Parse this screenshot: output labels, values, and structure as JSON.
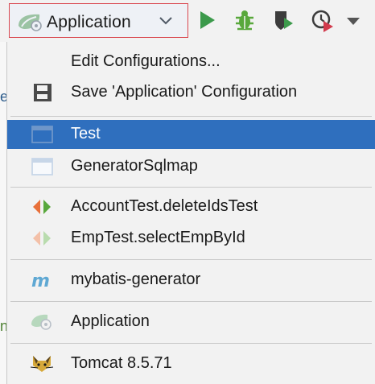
{
  "toolbar": {
    "run_config_label": "Application",
    "run_config_icon": "application-config-icon",
    "buttons": [
      {
        "name": "run-button",
        "icon": "run-icon",
        "color": "#3c9a4b"
      },
      {
        "name": "debug-button",
        "icon": "bug-icon",
        "color": "#59a83c"
      },
      {
        "name": "coverage-button",
        "icon": "shield-run-icon",
        "color": "#3c3c3c"
      },
      {
        "name": "profile-button",
        "icon": "clock-run-icon",
        "color": "#d23b4d"
      },
      {
        "name": "more-button",
        "icon": "caret-down-icon",
        "color": "#555555"
      }
    ]
  },
  "left_edge": {
    "chars": [
      "e",
      "n"
    ]
  },
  "menu": {
    "items": [
      {
        "label": "Edit Configurations...",
        "icon": "none"
      },
      {
        "label": "Save 'Application' Configuration",
        "icon": "floppy-disk-icon"
      },
      {
        "label": "Test",
        "icon": "application-window-icon",
        "selected": true
      },
      {
        "label": "GeneratorSqlmap",
        "icon": "application-window-icon"
      },
      {
        "label": "AccountTest.deleteIdsTest",
        "icon": "junit-test-icon"
      },
      {
        "label": "EmpTest.selectEmpById",
        "icon": "junit-test-faded-icon"
      },
      {
        "label": "mybatis-generator",
        "icon": "maven-m-icon"
      },
      {
        "label": "Application",
        "icon": "spring-boot-icon"
      },
      {
        "label": "Tomcat 8.5.71",
        "icon": "tomcat-icon"
      }
    ]
  },
  "colors": {
    "selection": "#2f6fbe",
    "combo_border": "#d9474f",
    "menu_background": "#f2f2f2"
  }
}
